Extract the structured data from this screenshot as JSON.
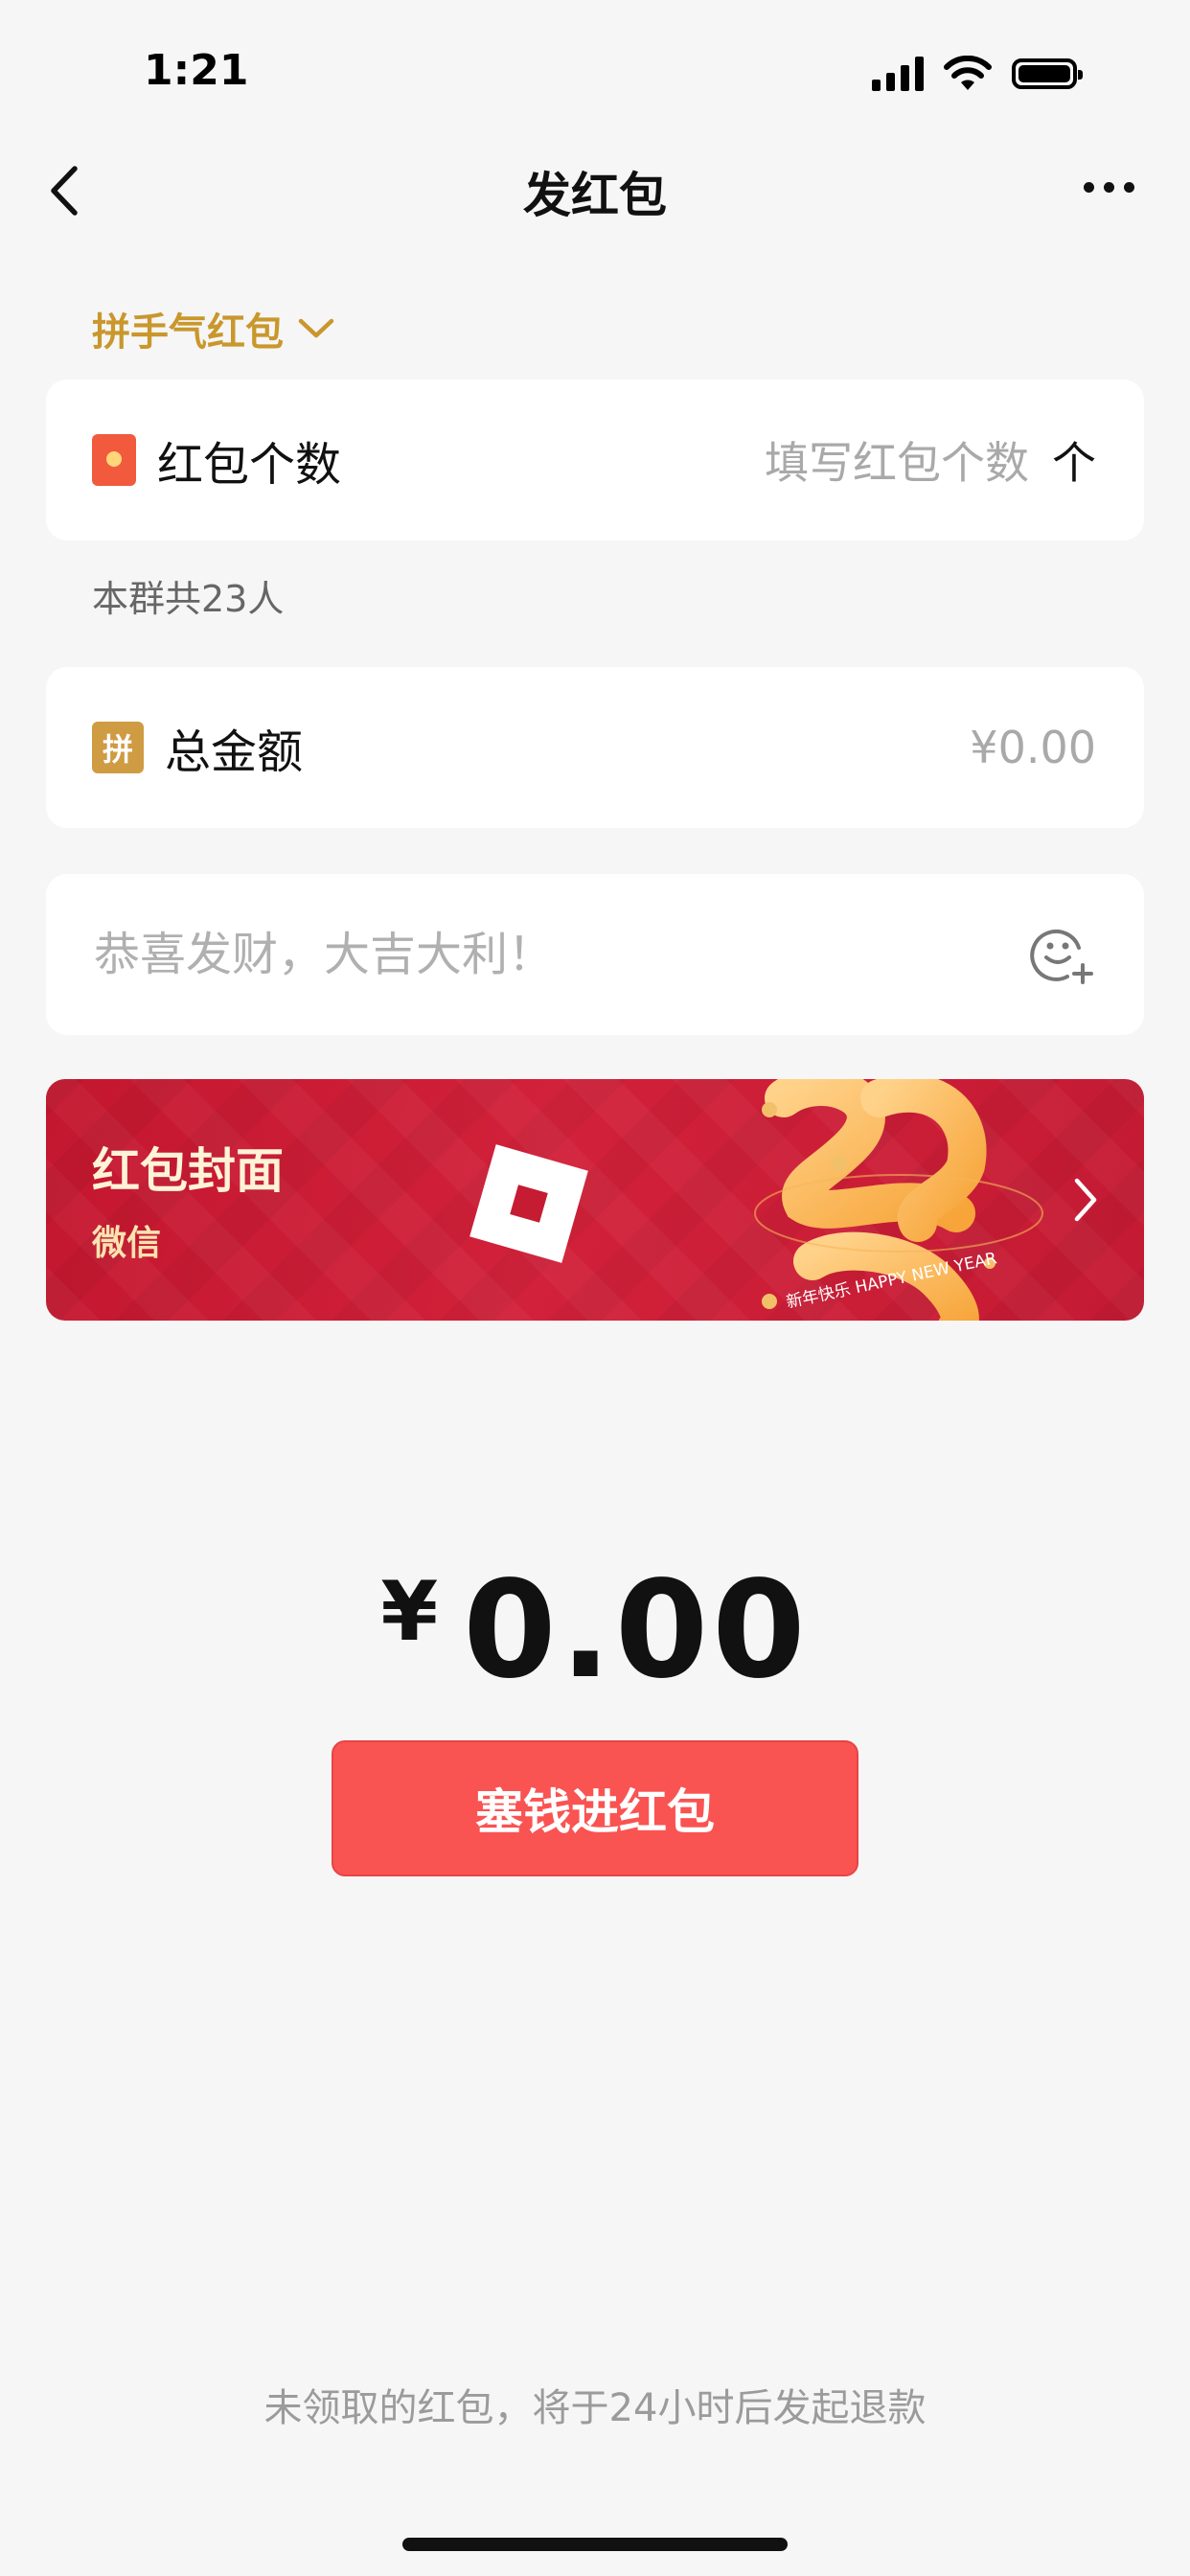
{
  "status_bar": {
    "time": "1:21"
  },
  "nav": {
    "title": "发红包"
  },
  "type_selector": {
    "label": "拼手气红包"
  },
  "count_card": {
    "label": "红包个数",
    "placeholder": "填写红包个数",
    "unit": "个"
  },
  "group_info": {
    "text": "本群共23人"
  },
  "amount_card": {
    "icon_text": "拼",
    "label": "总金额",
    "value": "¥0.00"
  },
  "blessing": {
    "placeholder": "恭喜发财，大吉大利！"
  },
  "cover": {
    "title": "红包封面",
    "subtitle": "微信",
    "art_caption": "新年快乐 HAPPY NEW YEAR"
  },
  "amount_display": {
    "currency": "¥",
    "value": "0.00"
  },
  "submit": {
    "label": "塞钱进红包"
  },
  "footer": {
    "note": "未领取的红包，将于24小时后发起退款"
  },
  "colors": {
    "accent_gold": "#c9972c",
    "button_red": "#f95352",
    "cover_red": "#c3172f"
  }
}
